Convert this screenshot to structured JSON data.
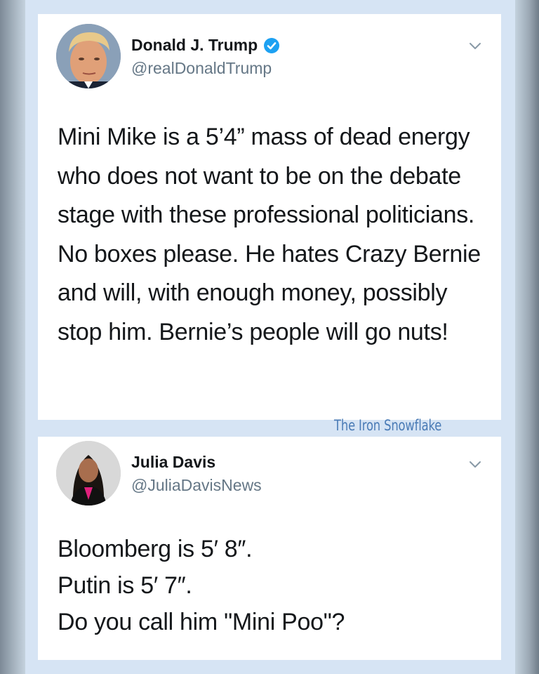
{
  "tweets": [
    {
      "display_name": "Donald J. Trump",
      "handle": "@realDonaldTrump",
      "verified": true,
      "text": "Mini Mike is a 5’4” mass of dead energy who does not want to be on the debate stage with these professional politicians. No boxes please. He hates Crazy Bernie and will, with enough money, possibly stop him. Bernie’s people will go nuts!"
    },
    {
      "display_name": "Julia Davis",
      "handle": "@JuliaDavisNews",
      "verified": false,
      "text_lines": [
        "Bloomberg is 5′ 8″.",
        "Putin is 5′ 7″.",
        "Do you call him \"Mini Poo\"?"
      ]
    }
  ],
  "watermark": "The Iron Snowflake",
  "colors": {
    "background": "#d6e4f4",
    "card": "#ffffff",
    "text": "#14171a",
    "handle": "#657786",
    "verified_badge": "#1da1f2",
    "watermark": "#4a7bb6"
  },
  "icons": {
    "verified": "verified-badge-icon",
    "menu": "chevron-down-icon"
  }
}
